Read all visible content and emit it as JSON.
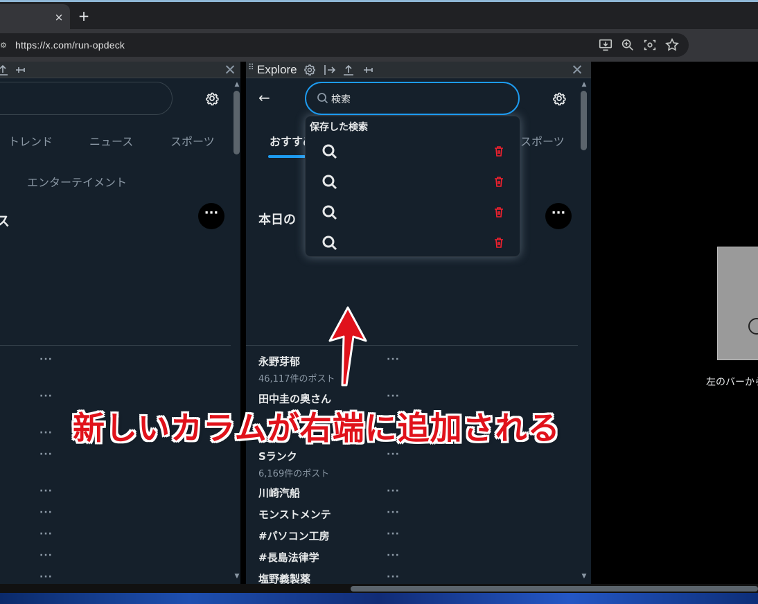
{
  "browser": {
    "tab_close": "×",
    "new_tab": "+",
    "url": "https://x.com/run-opdeck",
    "icons": [
      "install-icon",
      "zoom-icon",
      "lens-icon",
      "star-icon"
    ]
  },
  "left_column": {
    "close": "✕",
    "tabs": [
      "トレンド",
      "ニュース",
      "スポーツ",
      "エンターテイメント"
    ],
    "heading_fragment": "ス",
    "more": "···",
    "dots": "···"
  },
  "explore_column": {
    "title": "Explore",
    "close": "✕",
    "back": "←",
    "search_value": "検索",
    "tab_selected": "おすすめ",
    "tab_right": "スポーツ",
    "heading_fragment": "本日の",
    "more": "···",
    "dropdown": {
      "title": "保存した検索",
      "rows": 4
    },
    "trends": [
      {
        "title": "永野芽郁",
        "count": "46,117件のポスト"
      },
      {
        "title": "田中圭の奥さん",
        "count": ""
      },
      {
        "title": "Sランク",
        "count": "6,169件のポスト"
      },
      {
        "title": "川崎汽船",
        "count": ""
      },
      {
        "title": "モンストメンテ",
        "count": ""
      },
      {
        "title": "#パソコン工房",
        "count": ""
      },
      {
        "title": "#長島法律学",
        "count": ""
      },
      {
        "title": "塩野義製薬",
        "count": ""
      }
    ],
    "dots": "···"
  },
  "right_area": {
    "caption": "左のバーから"
  },
  "annotation": {
    "text": "新しいカラムが右端に追加される",
    "color": "#e0121b"
  },
  "colors": {
    "column_bg": "#15202b",
    "accent": "#1d9bf0",
    "danger": "#f4212e"
  }
}
